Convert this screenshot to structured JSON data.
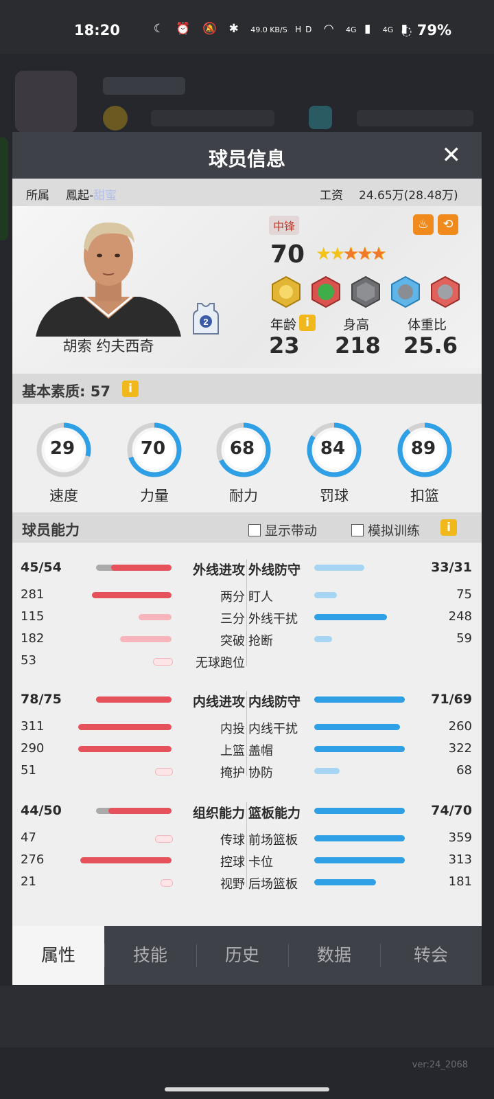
{
  "status_bar": {
    "time": "18:20",
    "network_speed": "49.0 KB/S",
    "signal_1": "4G",
    "signal_2": "4G",
    "battery": "79%"
  },
  "dialog": {
    "title": "球员信息",
    "team_label": "所属",
    "team_name": "鳳起-",
    "team_name_dim": "甜蜜",
    "salary_label": "工资",
    "salary_value": "24.65万(28.48万)"
  },
  "player": {
    "name": "胡索 约夫西奇",
    "jersey_number": "2",
    "position": "中锋",
    "overall": "70",
    "stars_full": 5,
    "stars_orange": 3,
    "age_label": "年龄",
    "age": "23",
    "height_label": "身高",
    "height": "218",
    "weight_label": "体重比",
    "weight": "25.6"
  },
  "basic": {
    "title": "基本素质: 57",
    "info_icon": "i",
    "gauges": [
      {
        "label": "速度",
        "value": "29",
        "fill": 0.29
      },
      {
        "label": "力量",
        "value": "70",
        "fill": 0.7
      },
      {
        "label": "耐力",
        "value": "68",
        "fill": 0.68
      },
      {
        "label": "罚球",
        "value": "84",
        "fill": 0.84
      },
      {
        "label": "扣篮",
        "value": "89",
        "fill": 0.89
      }
    ]
  },
  "ability": {
    "title": "球员能力",
    "show_band": "显示带动",
    "simulate_training": "模拟训练",
    "info_icon": "i",
    "groups": [
      {
        "left": {
          "label": "外线进攻",
          "value": "45/54",
          "fill": 0.8
        },
        "right": {
          "label": "外线防守",
          "value": "33/31",
          "fill": 0.55
        },
        "left_rows": [
          {
            "label": "两分",
            "value": "281",
            "fill": 0.85
          },
          {
            "label": "三分",
            "value": "115",
            "fill": 0.35
          },
          {
            "label": "突破",
            "value": "182",
            "fill": 0.55
          },
          {
            "label": "无球跑位",
            "value": "53",
            "fill": 0.2
          }
        ],
        "right_rows": [
          {
            "label": "盯人",
            "value": "75",
            "fill": 0.25
          },
          {
            "label": "外线干扰",
            "value": "248",
            "fill": 0.8
          },
          {
            "label": "抢断",
            "value": "59",
            "fill": 0.2
          }
        ]
      },
      {
        "left": {
          "label": "内线进攻",
          "value": "78/75",
          "fill": 1.0
        },
        "right": {
          "label": "内线防守",
          "value": "71/69",
          "fill": 1.0
        },
        "left_rows": [
          {
            "label": "内投",
            "value": "311",
            "fill": 1.0
          },
          {
            "label": "上篮",
            "value": "290",
            "fill": 1.0
          },
          {
            "label": "掩护",
            "value": "51",
            "fill": 0.18
          }
        ],
        "right_rows": [
          {
            "label": "内线干扰",
            "value": "260",
            "fill": 0.95
          },
          {
            "label": "盖帽",
            "value": "322",
            "fill": 1.0
          },
          {
            "label": "协防",
            "value": "68",
            "fill": 0.28
          }
        ]
      },
      {
        "left": {
          "label": "组织能力",
          "value": "44/50",
          "fill": 0.84
        },
        "right": {
          "label": "篮板能力",
          "value": "74/70",
          "fill": 1.0
        },
        "left_rows": [
          {
            "label": "传球",
            "value": "47",
            "fill": 0.18
          },
          {
            "label": "控球",
            "value": "276",
            "fill": 0.98
          },
          {
            "label": "视野",
            "value": "21",
            "fill": 0.12
          }
        ],
        "right_rows": [
          {
            "label": "前场篮板",
            "value": "359",
            "fill": 1.0
          },
          {
            "label": "卡位",
            "value": "313",
            "fill": 1.0
          },
          {
            "label": "后场篮板",
            "value": "181",
            "fill": 0.68
          }
        ]
      }
    ]
  },
  "tabs": [
    "属性",
    "技能",
    "历史",
    "数据",
    "转会"
  ],
  "version": "ver:24_2068",
  "colors": {
    "red": "#e5525b",
    "pink": "#f7b5bb",
    "blue": "#2f9fe6",
    "light_blue": "#a6d5f4",
    "accent_orange": "#f08a1c",
    "info_yellow": "#f0b81b"
  }
}
